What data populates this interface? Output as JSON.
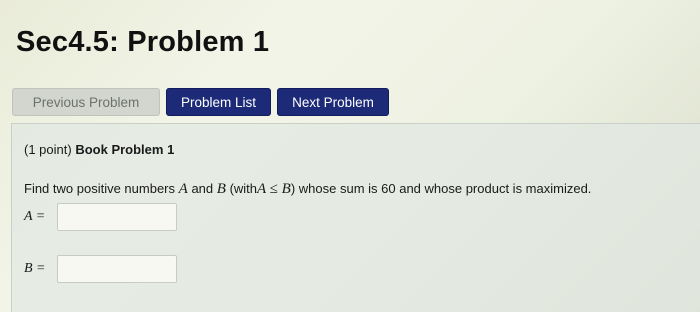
{
  "page": {
    "title": "Sec4.5: Problem 1"
  },
  "nav": {
    "previous_label": "Previous Problem",
    "list_label": "Problem List",
    "next_label": "Next Problem"
  },
  "problem": {
    "points": "(1 point)",
    "name": "Book Problem 1",
    "question_prefix": "Find two positive numbers",
    "var_a": "A",
    "and": "and",
    "var_b": "B",
    "with_open": "(with",
    "constraint": "A ≤ B",
    "with_close": ")",
    "question_suffix": "whose sum is 60 and whose product is maximized.",
    "answers": [
      {
        "label": "A =",
        "value": ""
      },
      {
        "label": "B =",
        "value": ""
      }
    ]
  },
  "colors": {
    "primary_button": "#1c2a78",
    "disabled_button": "#d2d6cf"
  }
}
